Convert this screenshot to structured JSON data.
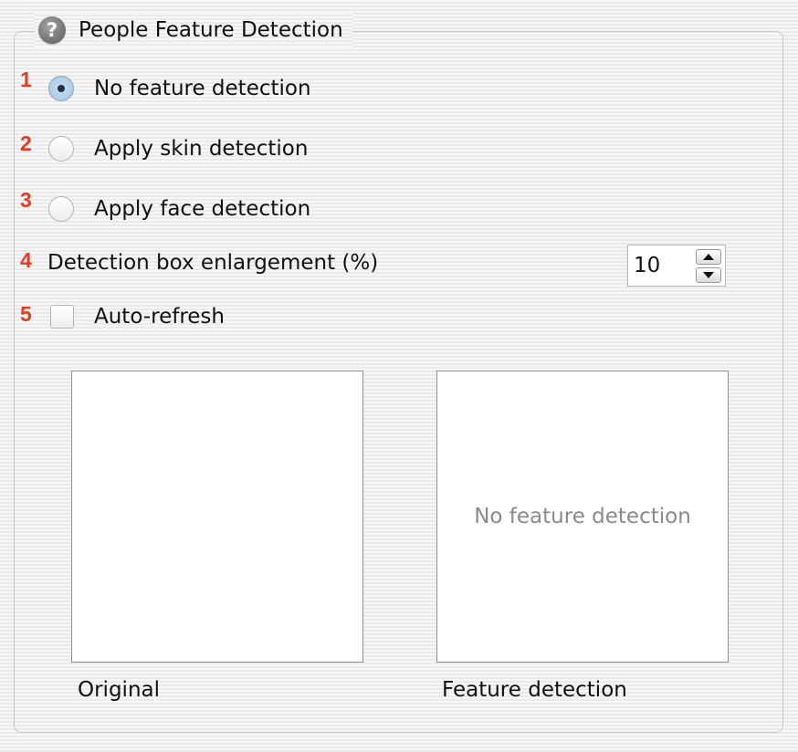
{
  "group": {
    "title": "People Feature Detection",
    "help_icon_glyph": "?"
  },
  "markers": [
    "1",
    "2",
    "3",
    "4",
    "5"
  ],
  "options": {
    "no_feature": {
      "label": "No feature detection",
      "checked": true
    },
    "skin": {
      "label": "Apply skin detection",
      "checked": false
    },
    "face": {
      "label": "Apply face detection",
      "checked": false
    }
  },
  "enlargement": {
    "label": "Detection box enlargement (%)",
    "value": "10"
  },
  "auto_refresh": {
    "label": "Auto-refresh",
    "checked": false
  },
  "previews": {
    "original_caption": "Original",
    "feature_caption": "Feature detection",
    "feature_placeholder": "No feature detection"
  },
  "colors": {
    "marker": "#e53b20",
    "placeholder_text": "#8a8a8a"
  }
}
